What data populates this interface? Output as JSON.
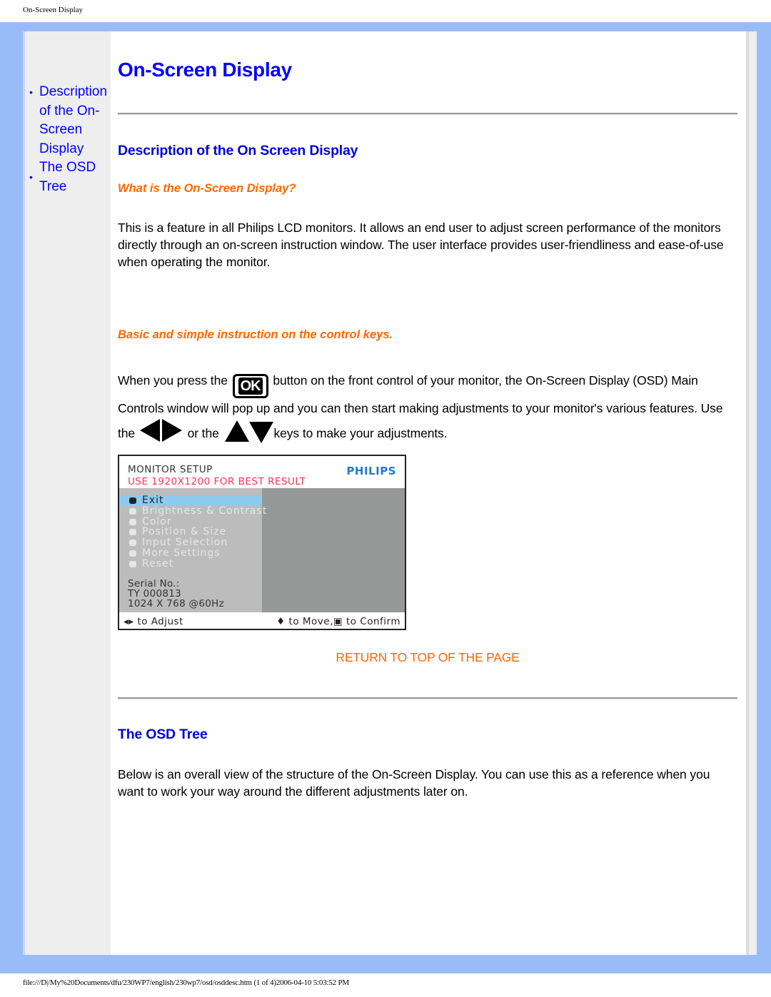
{
  "print_header": "On-Screen Display",
  "print_footer": "file:///D|/My%20Documents/dfu/230WP7/english/230wp7/osd/osddesc.htm (1 of 4)2006-04-10 5:03:52 PM",
  "sidebar": {
    "items": [
      {
        "label": "Description of the On-Screen Display"
      },
      {
        "label": "The OSD Tree"
      }
    ]
  },
  "main": {
    "title": "On-Screen Display",
    "section1": {
      "heading": "Description of the On Screen Display",
      "subheading1": "What is the On-Screen Display?",
      "paragraph1": "This is a feature in all Philips LCD monitors. It allows an end user to adjust screen performance of the monitors directly through an on-screen instruction window. The user interface provides user-friendliness and ease-of-use when operating the monitor.",
      "subheading2": "Basic and simple instruction on the control keys.",
      "p2_part1": "When you press the",
      "ok_key_label": "OK",
      "p2_part2": "button on the front control of your monitor, the On-Screen Display (OSD) Main Controls window will pop up and you can then start making adjustments to your monitor's various features. Use the",
      "p2_part3": "or the",
      "p2_part4": "keys to make your adjustments."
    },
    "osd_screenshot": {
      "header": "MONITOR SETUP",
      "subheader": "USE 1920X1200 FOR BEST RESULT",
      "brand": "PHILIPS",
      "menu": [
        {
          "label": "Exit",
          "icon": "exit-icon",
          "selected": true
        },
        {
          "label": "Brightness & Contrast",
          "icon": "brightness-icon"
        },
        {
          "label": "Color",
          "icon": "color-icon"
        },
        {
          "label": "Position & Size",
          "icon": "position-icon"
        },
        {
          "label": "Input Selection",
          "icon": "input-icon"
        },
        {
          "label": "More Settings",
          "icon": "settings-icon"
        },
        {
          "label": "Reset",
          "icon": "reset-icon"
        }
      ],
      "serial_label": "Serial No.:",
      "serial_value": "TY 000813",
      "resolution": "1024 X 768 @60Hz",
      "footer_left": "◂▸ to Adjust",
      "footer_right": "♦ to Move,▣ to Confirm"
    },
    "return_link": "RETURN TO TOP OF THE PAGE",
    "section2": {
      "heading": "The OSD Tree",
      "paragraph": "Below is an overall view of the structure of the On-Screen Display. You can use this as a reference when you want to work your way around the different adjustments later on."
    }
  },
  "colors": {
    "frame": "#99bbf7",
    "link": "#0000ff",
    "accent_orange": "#ff6600",
    "sidebar_bg": "#eeeeee"
  }
}
